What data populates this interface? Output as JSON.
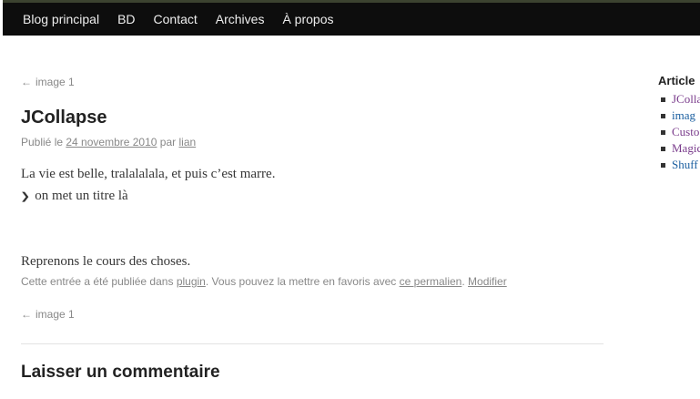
{
  "nav": {
    "items": [
      {
        "label": "Blog principal"
      },
      {
        "label": "BD"
      },
      {
        "label": "Contact"
      },
      {
        "label": "Archives"
      },
      {
        "label": "À propos"
      }
    ]
  },
  "post": {
    "prev_arrow": "←",
    "prev_label": "image 1",
    "title": "JCollapse",
    "meta": {
      "prefix": "Publié le",
      "date": "24 novembre 2010",
      "by": "par",
      "author": "lian"
    },
    "paragraph1": "La vie est belle, tralalalala, et puis c’est marre.",
    "toggle_label": "on met un titre là",
    "paragraph2": "Reprenons le cours des choses.",
    "footer": {
      "prefix": "Cette entrée a été publiée dans",
      "category": "plugin",
      "middle": ". Vous pouvez la mettre en favoris avec",
      "permalink": "ce permalien",
      "separator": ".",
      "edit": "Modifier"
    }
  },
  "comments": {
    "title": "Laisser un commentaire"
  },
  "sidebar": {
    "title": "Article",
    "items": [
      {
        "label": "JColla",
        "color": "#7a3c8c"
      },
      {
        "label": "imag",
        "color": "#1b5fa0"
      },
      {
        "label": "Custo",
        "color": "#7a3c8c"
      },
      {
        "label": "Magic",
        "color": "#7a3c8c"
      },
      {
        "label": "Shuff",
        "color": "#1b5fa0"
      }
    ]
  },
  "colors": {
    "nav_bg": "#0d0d0d",
    "nav_text": "#eeeeee",
    "link_visited": "#7a3c8c",
    "link": "#1b5fa0"
  }
}
